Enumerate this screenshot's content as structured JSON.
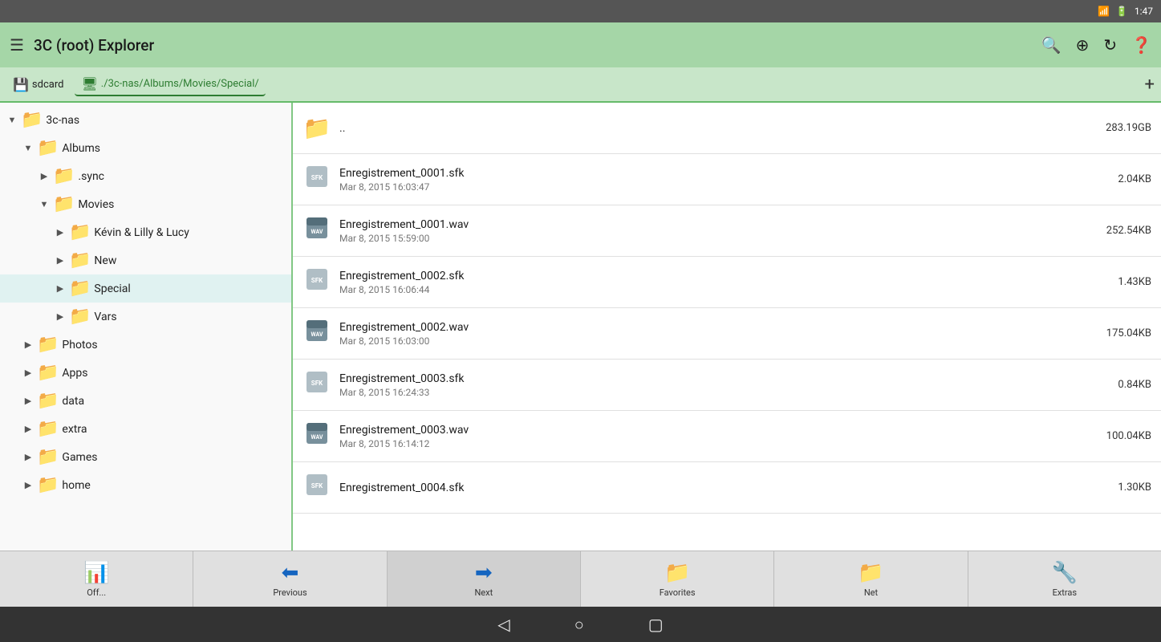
{
  "status_bar": {
    "time": "1:47",
    "icons": [
      "signal",
      "battery"
    ]
  },
  "top_bar": {
    "title": "3C (root) Explorer",
    "toolbar": {
      "search_label": "search",
      "add_label": "add-circle",
      "refresh_label": "refresh",
      "help_label": "help"
    }
  },
  "breadcrumb": {
    "items": [
      {
        "id": "sdcard",
        "label": "sdcard",
        "active": false
      },
      {
        "id": "3c-nas",
        "label": "./3c-nas/Albums/Movies/Special/",
        "active": true
      }
    ],
    "add_label": "+"
  },
  "sidebar": {
    "items": [
      {
        "id": "3c-nas",
        "label": "3c-nas",
        "indent": 0,
        "arrow": "▼",
        "selected": false
      },
      {
        "id": "Albums",
        "label": "Albums",
        "indent": 1,
        "arrow": "▼",
        "selected": false
      },
      {
        "id": ".sync",
        "label": ".sync",
        "indent": 2,
        "arrow": "▶",
        "selected": false
      },
      {
        "id": "Movies",
        "label": "Movies",
        "indent": 2,
        "arrow": "▼",
        "selected": false
      },
      {
        "id": "Kevin",
        "label": "Kévin & Lilly & Lucy",
        "indent": 3,
        "arrow": "▶",
        "selected": false
      },
      {
        "id": "New",
        "label": "New",
        "indent": 3,
        "arrow": "▶",
        "selected": false
      },
      {
        "id": "Special",
        "label": "Special",
        "indent": 3,
        "arrow": "▶",
        "selected": true
      },
      {
        "id": "Vars",
        "label": "Vars",
        "indent": 3,
        "arrow": "▶",
        "selected": false
      },
      {
        "id": "Photos",
        "label": "Photos",
        "indent": 1,
        "arrow": "▶",
        "selected": false
      },
      {
        "id": "Apps",
        "label": "Apps",
        "indent": 1,
        "arrow": "▶",
        "selected": false
      },
      {
        "id": "data",
        "label": "data",
        "indent": 1,
        "arrow": "▶",
        "selected": false
      },
      {
        "id": "extra",
        "label": "extra",
        "indent": 1,
        "arrow": "▶",
        "selected": false
      },
      {
        "id": "Games",
        "label": "Games",
        "indent": 1,
        "arrow": "▶",
        "selected": false
      },
      {
        "id": "home",
        "label": "home",
        "indent": 1,
        "arrow": "▶",
        "selected": false
      }
    ]
  },
  "file_list": {
    "items": [
      {
        "id": "parent",
        "name": "..",
        "date": "",
        "size": "283.19GB",
        "type": "folder"
      },
      {
        "id": "f1",
        "name": "Enregistrement_0001.sfk",
        "date": "Mar 8, 2015 16:03:47",
        "size": "2.04KB",
        "type": "sfk"
      },
      {
        "id": "f2",
        "name": "Enregistrement_0001.wav",
        "date": "Mar 8, 2015 15:59:00",
        "size": "252.54KB",
        "type": "wav"
      },
      {
        "id": "f3",
        "name": "Enregistrement_0002.sfk",
        "date": "Mar 8, 2015 16:06:44",
        "size": "1.43KB",
        "type": "sfk"
      },
      {
        "id": "f4",
        "name": "Enregistrement_0002.wav",
        "date": "Mar 8, 2015 16:03:00",
        "size": "175.04KB",
        "type": "wav"
      },
      {
        "id": "f5",
        "name": "Enregistrement_0003.sfk",
        "date": "Mar 8, 2015 16:24:33",
        "size": "0.84KB",
        "type": "sfk"
      },
      {
        "id": "f6",
        "name": "Enregistrement_0003.wav",
        "date": "Mar 8, 2015 16:14:12",
        "size": "100.04KB",
        "type": "wav"
      },
      {
        "id": "f7",
        "name": "Enregistrement_0004.sfk",
        "date": "",
        "size": "1.30KB",
        "type": "sfk"
      }
    ]
  },
  "bottom_nav": {
    "items": [
      {
        "id": "offline",
        "label": "Off...",
        "icon": "📊"
      },
      {
        "id": "previous",
        "label": "Previous",
        "icon": "⬅"
      },
      {
        "id": "next",
        "label": "Next",
        "icon": "➡"
      },
      {
        "id": "favorites",
        "label": "Favorites",
        "icon": "📁"
      },
      {
        "id": "net",
        "label": "Net",
        "icon": "📁"
      },
      {
        "id": "extras",
        "label": "Extras",
        "icon": "🔧"
      }
    ]
  },
  "android_nav": {
    "back_label": "◁",
    "home_label": "○",
    "recents_label": "▢"
  }
}
